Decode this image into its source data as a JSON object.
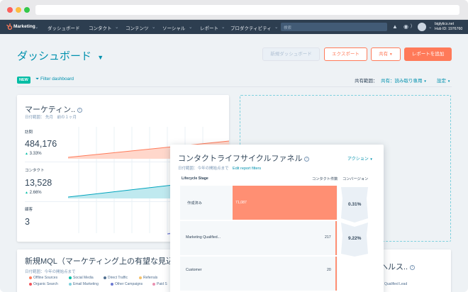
{
  "app": {
    "brand_name": "Marketing",
    "nav_items": [
      "ダッシュボード",
      "コンタクト",
      "コンテンツ",
      "ソーシャル",
      "レポート",
      "プロダクティビティ"
    ],
    "search_placeholder": "検索",
    "account": {
      "domain": "biglytics.net",
      "hub_id": "Hub ID: 1976760"
    }
  },
  "header": {
    "title": "ダッシュボード",
    "buttons": {
      "new_dashboard": "新規ダッシュボード",
      "export": "エクスポート",
      "share": "共有",
      "add_report": "レポートを追加"
    },
    "new_badge": "NEW",
    "filter_label": "Filter dashboard",
    "sharing_label": "共有範囲：",
    "sharing_value": "共有：読み取り専用",
    "settings_label": "設定"
  },
  "marketing_card": {
    "title": "マーケティン..",
    "date_range": "日付範囲： 先月　前の１ヶ月",
    "metrics": [
      {
        "label": "訪問",
        "value": "484,176",
        "change": "3.33%"
      },
      {
        "label": "コンタクト",
        "value": "13,528",
        "change": "2.66%"
      },
      {
        "label": "顧客",
        "value": "3",
        "change": ""
      }
    ]
  },
  "mql_card": {
    "title": "新規MQL（マーケティング上の有望な見込",
    "date_range": "日付範囲：今年の開始点まで",
    "legend": [
      {
        "label": "Offline Sources",
        "color": "#ff7a59"
      },
      {
        "label": "Social Media",
        "color": "#00bda5"
      },
      {
        "label": "Direct Traffic",
        "color": "#516f90"
      },
      {
        "label": "Referrals",
        "color": "#f5c26b"
      },
      {
        "label": "Organic Search",
        "color": "#f2545b"
      },
      {
        "label": "Email Marketing",
        "color": "#7fd1de"
      },
      {
        "label": "Other Campaigns",
        "color": "#6a78d1"
      },
      {
        "label": "Paid S",
        "color": "#ea90b1"
      }
    ]
  },
  "right_bottom_card": {
    "title_fragment": "ヘルス..",
    "legend_fragment": "Qualified Lead"
  },
  "funnel_card": {
    "title": "コンタクトライフサイクルファネル",
    "action_label": "アクション",
    "date_range": "日付範囲：今年の開始点まで",
    "edit_filters": "Edit report filters",
    "col_stage": "Lifecycle Stage",
    "col_count": "コンタクト件数",
    "col_conversion": "コンバージョン",
    "rows": [
      {
        "stage": "作成済み",
        "count": "71,087",
        "conversion": "0.31%"
      },
      {
        "stage": "Marketing Qualified...",
        "count": "217",
        "conversion": "9.22%"
      },
      {
        "stage": "Customer",
        "count": "20",
        "conversion": ""
      }
    ]
  },
  "colors": {
    "nav_bg": "#2d3e50",
    "accent_orange": "#ff7a59",
    "accent_teal": "#0091ae",
    "positive_green": "#00bda5",
    "funnel_bar": "#ff8f73"
  }
}
